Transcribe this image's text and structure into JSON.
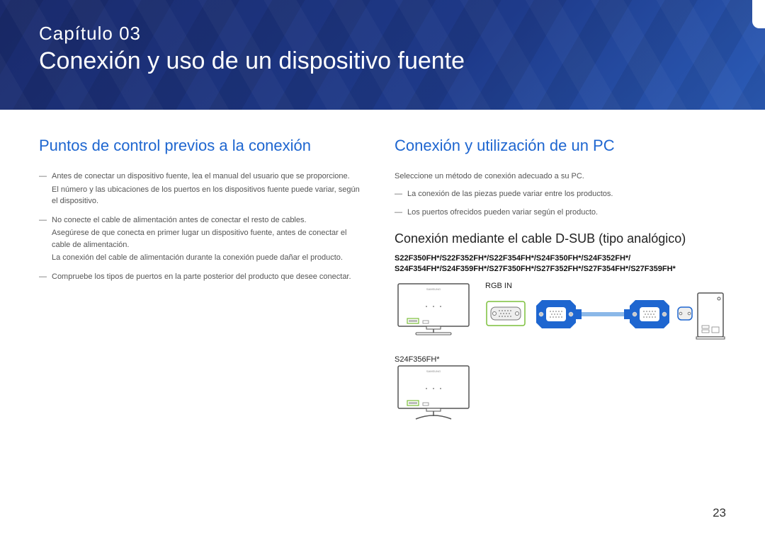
{
  "banner": {
    "chapter": "Capítulo 03",
    "title": "Conexión y uso de un dispositivo fuente"
  },
  "left": {
    "heading": "Puntos de control previos a la conexión",
    "notes": [
      {
        "lines": [
          "Antes de conectar un dispositivo fuente, lea el manual del usuario que se proporcione.",
          "El número y las ubicaciones de los puertos en los dispositivos fuente puede variar, según el dispositivo."
        ]
      },
      {
        "lines": [
          "No conecte el cable de alimentación antes de conectar el resto de cables.",
          "Asegúrese de que conecta en primer lugar un dispositivo fuente, antes de conectar el cable de alimentación.",
          "La conexión del cable de alimentación durante la conexión puede dañar el producto."
        ]
      },
      {
        "lines": [
          "Compruebe los tipos de puertos en la parte posterior del producto que desee conectar."
        ]
      }
    ]
  },
  "right": {
    "heading": "Conexión y utilización de un PC",
    "intro": "Seleccione un método de conexión adecuado a su PC.",
    "bullets": [
      "La conexión de las piezas puede variar entre los productos.",
      "Los puertos ofrecidos pueden variar según el producto."
    ],
    "subheading": "Conexión mediante el cable D-SUB (tipo analógico)",
    "models_line1": "S22F350FH*/S22F352FH*/S22F354FH*/S24F350FH*/S24F352FH*/",
    "models_line2": "S24F354FH*/S24F359FH*/S27F350FH*/S27F352FH*/S27F354FH*/S27F359FH*",
    "monitor2_label": "S24F356FH*",
    "rgb_in": "RGB IN"
  },
  "page_number": "23"
}
